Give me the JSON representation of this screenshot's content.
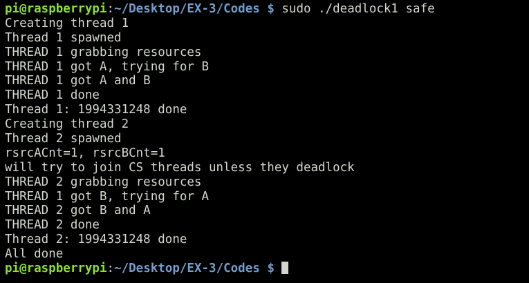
{
  "prompt": {
    "user_host": "pi@raspberrypi",
    "colon": ":",
    "path": "~/Desktop/EX-3/Codes",
    "symbol": " $ "
  },
  "command": "sudo ./deadlock1 safe",
  "output_lines": [
    "Creating thread 1",
    "Thread 1 spawned",
    "THREAD 1 grabbing resources",
    "THREAD 1 got A, trying for B",
    "THREAD 1 got A and B",
    "THREAD 1 done",
    "Thread 1: 1994331248 done",
    "Creating thread 2",
    "Thread 2 spawned",
    "rsrcACnt=1, rsrcBCnt=1",
    "will try to join CS threads unless they deadlock",
    "THREAD 2 grabbing resources",
    "THREAD 1 got B, trying for A",
    "THREAD 2 got B and A",
    "THREAD 2 done",
    "Thread 2: 1994331248 done",
    "All done"
  ],
  "colors": {
    "background": "#000000",
    "text": "#d3d7cf",
    "user_host": "#8ae234",
    "path": "#729fcf"
  }
}
